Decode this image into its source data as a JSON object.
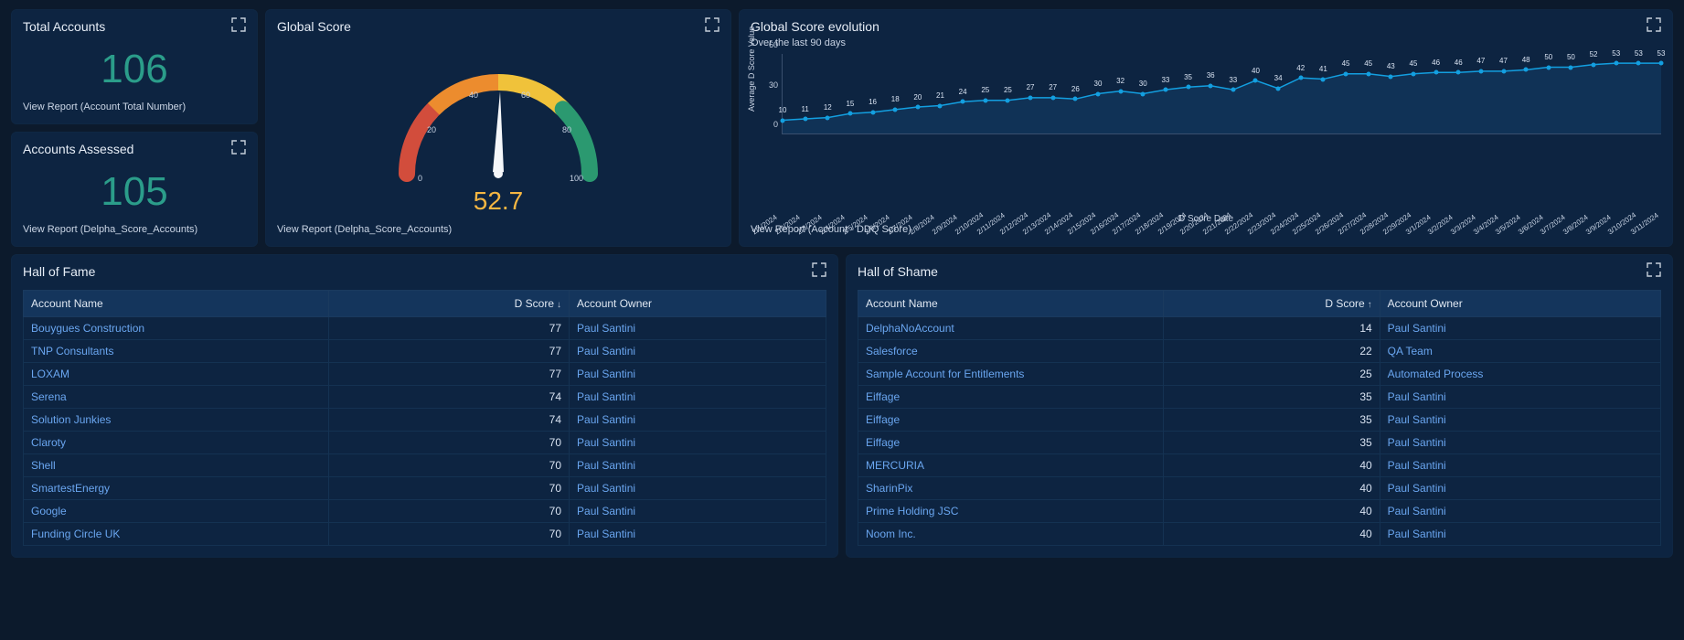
{
  "totalAccounts": {
    "title": "Total Accounts",
    "value": "106",
    "report": "View Report (Account Total Number)"
  },
  "accountsAssessed": {
    "title": "Accounts Assessed",
    "value": "105",
    "report": "View Report (Delpha_Score_Accounts)"
  },
  "globalScore": {
    "title": "Global Score",
    "value": "52.7",
    "report": "View Report (Delpha_Score_Accounts)",
    "ticks": [
      "0",
      "20",
      "40",
      "60",
      "80",
      "100"
    ]
  },
  "evolution": {
    "title": "Global Score evolution",
    "subtitle": "Over the last 90 days",
    "ylabel": "Average D Score Value",
    "xlabel": "D Score Date",
    "report": "View Report (Account - DDQ Score)",
    "yticks": [
      "0",
      "30",
      "60"
    ]
  },
  "chart_data": {
    "type": "line",
    "title": "Global Score evolution",
    "ylabel": "Average D Score Value",
    "xlabel": "D Score Date",
    "ylim": [
      0,
      60
    ],
    "categories": [
      "2/1/2024",
      "2/2/2024",
      "2/3/2024",
      "2/4/2024",
      "2/5/2024",
      "2/6/2024",
      "2/7/2024",
      "2/8/2024",
      "2/9/2024",
      "2/10/2024",
      "2/11/2024",
      "2/12/2024",
      "2/13/2024",
      "2/14/2024",
      "2/15/2024",
      "2/16/2024",
      "2/17/2024",
      "2/18/2024",
      "2/19/2024",
      "2/20/2024",
      "2/21/2024",
      "2/22/2024",
      "2/23/2024",
      "2/24/2024",
      "2/25/2024",
      "2/26/2024",
      "2/27/2024",
      "2/28/2024",
      "2/29/2024",
      "3/1/2024",
      "3/2/2024",
      "3/3/2024",
      "3/4/2024",
      "3/5/2024",
      "3/6/2024",
      "3/7/2024",
      "3/8/2024",
      "3/9/2024",
      "3/10/2024",
      "3/11/2024"
    ],
    "values": [
      10,
      11,
      12,
      15,
      16,
      18,
      20,
      21,
      24,
      25,
      25,
      27,
      27,
      26,
      30,
      32,
      30,
      33,
      35,
      36,
      33,
      40,
      34,
      42,
      41,
      45,
      45,
      43,
      45,
      46,
      46,
      47,
      47,
      48,
      50,
      50,
      52,
      53,
      53,
      53
    ]
  },
  "hallOfFame": {
    "title": "Hall of Fame",
    "headers": {
      "name": "Account Name",
      "score": "D Score",
      "owner": "Account Owner"
    },
    "sortArrow": "↓",
    "rows": [
      {
        "name": "Bouygues Construction",
        "score": "77",
        "owner": "Paul Santini"
      },
      {
        "name": "TNP Consultants",
        "score": "77",
        "owner": "Paul Santini"
      },
      {
        "name": "LOXAM",
        "score": "77",
        "owner": "Paul Santini"
      },
      {
        "name": "Serena",
        "score": "74",
        "owner": "Paul Santini"
      },
      {
        "name": "Solution Junkies",
        "score": "74",
        "owner": "Paul Santini"
      },
      {
        "name": "Claroty",
        "score": "70",
        "owner": "Paul Santini"
      },
      {
        "name": "Shell",
        "score": "70",
        "owner": "Paul Santini"
      },
      {
        "name": "SmartestEnergy",
        "score": "70",
        "owner": "Paul Santini"
      },
      {
        "name": "Google",
        "score": "70",
        "owner": "Paul Santini"
      },
      {
        "name": "Funding Circle UK",
        "score": "70",
        "owner": "Paul Santini"
      }
    ]
  },
  "hallOfShame": {
    "title": "Hall of Shame",
    "headers": {
      "name": "Account Name",
      "score": "D Score",
      "owner": "Account Owner"
    },
    "sortArrow": "↑",
    "rows": [
      {
        "name": "DelphaNoAccount",
        "score": "14",
        "owner": "Paul Santini"
      },
      {
        "name": "Salesforce",
        "score": "22",
        "owner": "QA Team"
      },
      {
        "name": "Sample Account for Entitlements",
        "score": "25",
        "owner": "Automated Process"
      },
      {
        "name": "Eiffage",
        "score": "35",
        "owner": "Paul Santini"
      },
      {
        "name": "Eiffage",
        "score": "35",
        "owner": "Paul Santini"
      },
      {
        "name": "Eiffage",
        "score": "35",
        "owner": "Paul Santini"
      },
      {
        "name": "MERCURIA",
        "score": "40",
        "owner": "Paul Santini"
      },
      {
        "name": "SharinPix",
        "score": "40",
        "owner": "Paul Santini"
      },
      {
        "name": "Prime Holding JSC",
        "score": "40",
        "owner": "Paul Santini"
      },
      {
        "name": "Noom Inc.",
        "score": "40",
        "owner": "Paul Santini"
      }
    ]
  }
}
